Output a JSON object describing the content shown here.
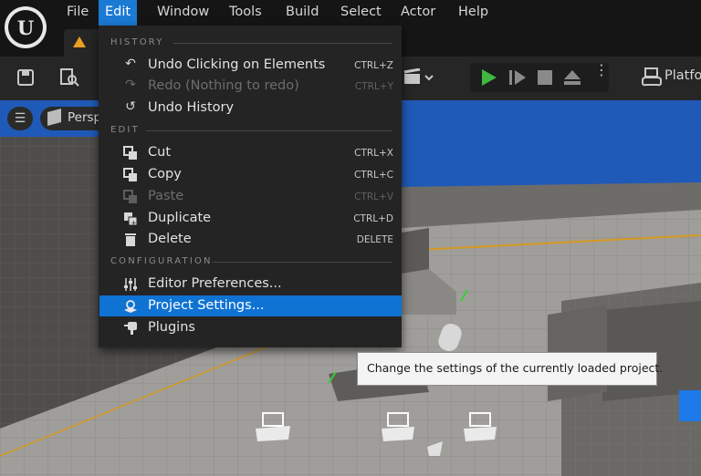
{
  "menubar": {
    "logo_text": "U",
    "items": [
      "File",
      "Edit",
      "Window",
      "Tools",
      "Build",
      "Select",
      "Actor",
      "Help"
    ],
    "active_item": "Edit"
  },
  "toolbar": {
    "platforms_label": "Platfo"
  },
  "viewport": {
    "view_mode_label": "Persp"
  },
  "dropdown": {
    "sections": {
      "history": "HISTORY",
      "edit": "EDIT",
      "configuration": "CONFIGURATION"
    },
    "items": [
      {
        "label": "Undo Clicking on Elements",
        "shortcut": "CTRL+Z",
        "icon": "undo-icon",
        "enabled": true
      },
      {
        "label": "Redo (Nothing to redo)",
        "shortcut": "CTRL+Y",
        "icon": "redo-icon",
        "enabled": false
      },
      {
        "label": "Undo History",
        "shortcut": "",
        "icon": "history-icon",
        "enabled": true
      },
      {
        "label": "Cut",
        "shortcut": "CTRL+X",
        "icon": "cut-icon",
        "enabled": true
      },
      {
        "label": "Copy",
        "shortcut": "CTRL+C",
        "icon": "copy-icon",
        "enabled": true
      },
      {
        "label": "Paste",
        "shortcut": "CTRL+V",
        "icon": "paste-icon",
        "enabled": false
      },
      {
        "label": "Duplicate",
        "shortcut": "CTRL+D",
        "icon": "duplicate-icon",
        "enabled": true
      },
      {
        "label": "Delete",
        "shortcut": "DELETE",
        "icon": "trash-icon",
        "enabled": true
      },
      {
        "label": "Editor Preferences...",
        "shortcut": "",
        "icon": "sliders-icon",
        "enabled": true
      },
      {
        "label": "Project Settings...",
        "shortcut": "",
        "icon": "project-settings-icon",
        "enabled": true,
        "highlighted": true
      },
      {
        "label": "Plugins",
        "shortcut": "",
        "icon": "plug-icon",
        "enabled": true
      }
    ]
  },
  "tooltip": {
    "text": "Change the settings of the currently loaded project."
  },
  "colors": {
    "accent": "#0f73d4",
    "menu_bg": "#242424",
    "play_green": "#3fb83f",
    "sky_blue": "#1f5ab8"
  }
}
